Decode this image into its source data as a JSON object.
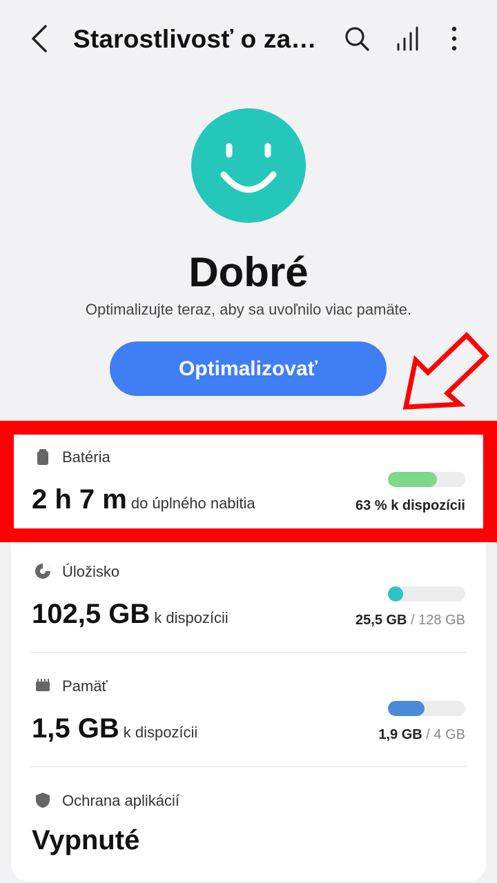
{
  "header": {
    "title": "Starostlivosť o zari…"
  },
  "status": {
    "title": "Dobré",
    "subtitle": "Optimalizujte teraz, aby sa uvoľnilo viac pamäte.",
    "optimize_label": "Optimalizovať"
  },
  "battery": {
    "label": "Batéria",
    "value": "2 h 7 m",
    "suffix": "do úplného nabitia",
    "right": "63 % k dispozícii",
    "level_percent": 63,
    "color": "#7ed88a"
  },
  "storage": {
    "label": "Úložisko",
    "value": "102,5 GB",
    "suffix": "k dispozícii",
    "used": "25,5 GB",
    "total": "/ 128 GB",
    "level_percent": 20,
    "color": "#2ec4c2"
  },
  "memory": {
    "label": "Pamäť",
    "value": "1,5 GB",
    "suffix": "k dispozícii",
    "used": "1,9 GB",
    "total": "/ 4 GB",
    "level_percent": 47,
    "color": "#4a8ad8"
  },
  "protection": {
    "label": "Ochrana aplikácií",
    "value": "Vypnuté"
  },
  "colors": {
    "accent": "#3f7ef5",
    "face": "#26c7bb",
    "highlight": "#ff0000"
  }
}
